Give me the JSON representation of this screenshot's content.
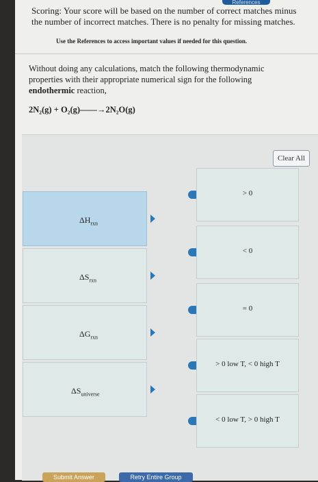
{
  "header": {
    "tab_label": "References"
  },
  "scoring_text": "Scoring: Your score will be based on the number of correct matches minus the number of incorrect matches. There is no penalty for missing matches.",
  "references_note": "Use the References to access important values if needed for this question.",
  "prompt": {
    "line1": "Without doing any calculations, match the following thermodynamic properties with their appropriate numerical sign for the following",
    "bold": "endothermic",
    "line2": " reaction,"
  },
  "equation": "2N₂(g) + O₂(g)——→2N₂O(g)",
  "clear_all_label": "Clear All",
  "properties": [
    {
      "symbol": "ΔH",
      "sub": "rxn",
      "selected": true
    },
    {
      "symbol": "ΔS",
      "sub": "rxn",
      "selected": false
    },
    {
      "symbol": "ΔG",
      "sub": "rxn",
      "selected": false
    },
    {
      "symbol": "ΔS",
      "sub": "universe",
      "selected": false
    }
  ],
  "targets": [
    {
      "label": "> 0"
    },
    {
      "label": "< 0"
    },
    {
      "label": "= 0"
    },
    {
      "label": "> 0 low T, < 0 high T"
    },
    {
      "label": "< 0 low T, > 0 high T"
    }
  ],
  "buttons": {
    "submit": "Submit Answer",
    "retry": "Retry Entire Group"
  }
}
